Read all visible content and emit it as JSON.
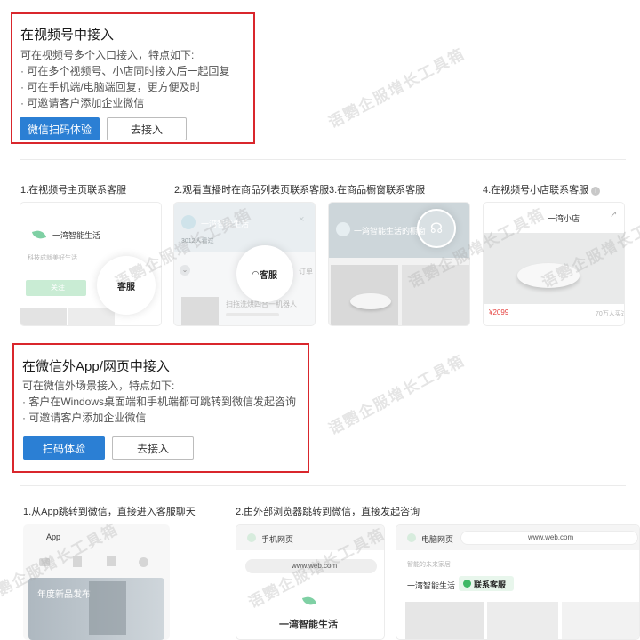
{
  "section1": {
    "title": "在视频号中接入",
    "subtitle": "可在视频号多个入口接入，特点如下:",
    "bullets": [
      "· 可在多个视频号、小店同时接入后一起回复",
      "· 可在手机端/电脑端回复，更方便及时",
      "· 可邀请客户添加企业微信"
    ],
    "primary_btn": "微信扫码体验",
    "secondary_btn": "去接入"
  },
  "channels_examples": [
    {
      "caption": "1.在视频号主页联系客服",
      "brand": "一湾智能生活",
      "sub": "科技成就美好生活",
      "follow": "关注",
      "badge": "客服"
    },
    {
      "caption": "2.观看直播时在商品列表页联系客服",
      "brand": "一湾智能生活",
      "sub": "3012人看过",
      "badge": "客服",
      "order": "订单",
      "product": "扫拖洗烘四合一机器人"
    },
    {
      "caption": "3.在商品橱窗联系客服",
      "brand": "一湾智能生活的橱窗"
    },
    {
      "caption": "4.在视频号小店联系客服",
      "brand": "一湾小店",
      "price": "¥2099",
      "sold": "70万人买过"
    }
  ],
  "section2": {
    "title": "在微信外App/网页中接入",
    "subtitle": "可在微信外场景接入，特点如下:",
    "bullets": [
      "· 客户在Windows桌面端和手机端都可跳转到微信发起咨询",
      "· 可邀请客户添加企业微信"
    ],
    "primary_btn": "扫码体验",
    "secondary_btn": "去接入"
  },
  "app_examples": {
    "caption1": "1.从App跳转到微信，直接进入客服聊天",
    "caption2": "2.由外部浏览器跳转到微信，直接发起咨询",
    "app_label": "App",
    "app_banner": "年度新品发布",
    "mobile_web_label": "手机网页",
    "url": "www.web.com",
    "brand": "一湾智能生活",
    "pc_web_label": "电脑网页",
    "pc_subtitle": "智能的未来家居",
    "contact_btn": "联系客服"
  },
  "watermark": "语鹦企服增长工具箱",
  "icons": {
    "info": "info-icon",
    "share": "share-icon",
    "close": "close-icon",
    "headset": "headset-icon",
    "chevron": "chevron-down-icon",
    "chat": "chat-icon"
  },
  "colors": {
    "accent": "#2b7fd4",
    "highlight": "#d9262c",
    "green": "#3fb866"
  }
}
